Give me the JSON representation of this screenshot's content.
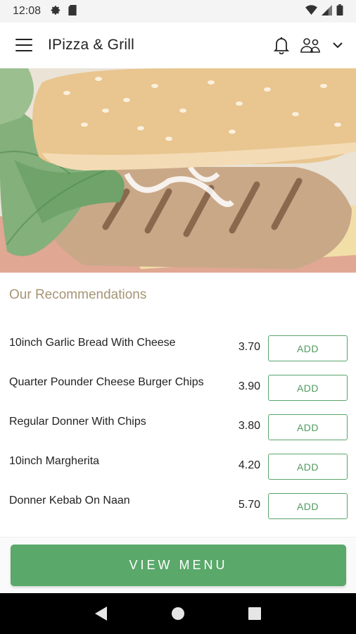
{
  "status_bar": {
    "time": "12:08",
    "icons": [
      "settings-gear-icon",
      "sim-card-icon",
      "wifi-icon",
      "signal-icon",
      "battery-icon"
    ]
  },
  "app_bar": {
    "title": "IPizza & Grill",
    "icons": [
      "hamburger-menu-icon",
      "bell-icon",
      "people-icon",
      "chevron-down-icon"
    ]
  },
  "recommendations": {
    "title": "Our Recommendations",
    "items": [
      {
        "name": "10inch Garlic Bread With Cheese",
        "price": "3.70",
        "action": "ADD"
      },
      {
        "name": "Quarter Pounder Cheese Burger Chips",
        "price": "3.90",
        "action": "ADD"
      },
      {
        "name": "Regular Donner With Chips",
        "price": "3.80",
        "action": "ADD"
      },
      {
        "name": "10inch Margherita",
        "price": "4.20",
        "action": "ADD"
      },
      {
        "name": "Donner Kebab On Naan",
        "price": "5.70",
        "action": "ADD"
      }
    ]
  },
  "view_menu_label": "VIEW MENU",
  "colors": {
    "accent_green": "#5aa86a",
    "title_tan": "#a59575"
  },
  "nav_bar": {
    "icons": [
      "back-icon",
      "home-icon",
      "recents-icon"
    ]
  }
}
